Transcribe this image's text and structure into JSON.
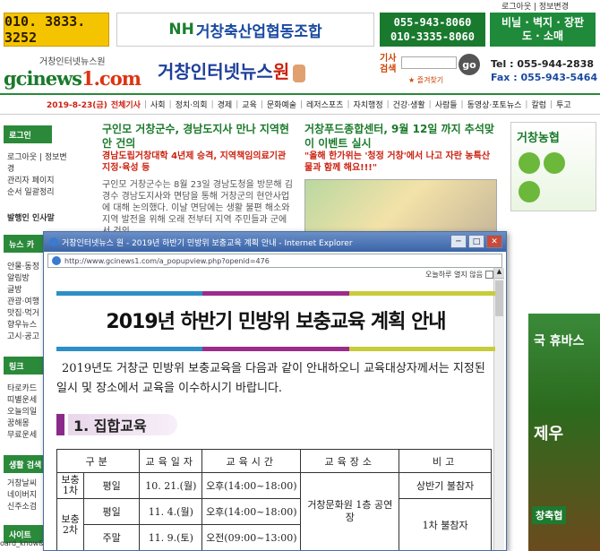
{
  "top_links": "로그아웃 | 정보변경",
  "ads": {
    "phone": "010. 3833. 3252",
    "nh_prefix": "NH",
    "nh_name": "거창축산업협동조합",
    "green_phone1": "055-943-8060",
    "green_phone2": "010-3335-8060",
    "green2_line1": "비닐 · 벽지 · 장판",
    "green2_line2": "도 · 소매"
  },
  "logo": {
    "small": "거창인터넷뉴스원",
    "big_main": "gcinews",
    "big_accent": "1.com"
  },
  "site_title": {
    "main": "거창인터넷뉴스",
    "accent": "원"
  },
  "search": {
    "label1": "기사",
    "label2": "검색",
    "go": "go",
    "favorites": "★ 즐겨찾기"
  },
  "contact": {
    "tel": "Tel : 055-944-2838",
    "fax": "Fax : 055-943-5464"
  },
  "nav": {
    "date": "2019-8-23(금)",
    "items": [
      "전체기사",
      "사회",
      "정치·의회",
      "경제",
      "교육",
      "문화예술",
      "레저스포츠",
      "자치행정",
      "건강·생활",
      "사람들",
      "동영상·포토뉴스",
      "칼럼",
      "투고"
    ]
  },
  "sidebar": {
    "login_head": "로그인",
    "login_links": [
      "로그아웃 | 정보변",
      "경",
      "관리자 페이지",
      "순서 일괄정리"
    ],
    "greeting": "발행인 인사말",
    "news_head": "뉴스 카",
    "news_items": [
      "안물·동정",
      "알림방",
      "글방",
      "관광·여행",
      "맛집·먹거",
      "향우뉴스",
      "고시·공고"
    ],
    "link_head": "링크",
    "link_items": [
      "타로카드",
      "띠별운세",
      "오늘의일",
      "꿈해몽",
      "무료운세"
    ],
    "life_head": "생활 검색",
    "life_items": [
      "거창날씨",
      "네이버지",
      "신주소검"
    ],
    "site_head": "사이트"
  },
  "news1": {
    "title": "구인모 거창군수, 경남도지사 만나 지역현안 건의",
    "sub": "경남도립거창대학 4년제 승격, 지역책임의료기관 지정·육성 등",
    "body": "구인모 거창군수는 8월 23일 경남도청을 방문해 김경수 경남도지사와 면담을 통해 거창군의 현안사업에 대해 논의했다. 이날 면담에는 생활 불편 해소와 지역 발전을 위해 오래 전부터 지역 주민들과 군에서 건의"
  },
  "news2": {
    "title": "거창푸드종합센터, 9월 12일 까지 추석맞이 이벤트 실시",
    "sub": "\"올해 한가위는 '청정 거창'에서 나고 자란 농특산물과 함께 해요!!!\""
  },
  "right_ad": {
    "title": "거창농협",
    "bottom_text": "국 휴바스",
    "bottom_label": "창축협",
    "mid": "제우"
  },
  "status_text": "oard_know&",
  "popup": {
    "title": "거창인터넷뉴스 원 - 2019년 하반기 민방위 보충교육 계획 안내 - Internet Explorer",
    "url": "http://www.gcinews1.com/a_popupview.php?openid=476",
    "dont_show": "오늘하루 열지 않음",
    "buttons": [
      "─",
      "□",
      "✕"
    ],
    "stripe_colors": [
      "#2c8fc7",
      "#9b2c8c",
      "#c7cc3a"
    ],
    "doc_title": "2019년 하반기 민방위 보충교육 계획 안내",
    "intro": "2019년도 거창군 민방위 보충교육을 다음과 같이 안내하오니 교육대상자께서는 지정된 일시 및 장소에서 교육을 이수하시기 바랍니다.",
    "section": "1. 집합교육",
    "table": {
      "headers": [
        "구분",
        "교육일자",
        "교육시간",
        "교육장소",
        "비고"
      ],
      "group1": "보충 1차",
      "group2": "보충 2차",
      "rows": [
        {
          "type": "평일",
          "date": "10. 21.(월)",
          "time": "오후(14:00~18:00)"
        },
        {
          "type": "평일",
          "date": "11. 4.(월)",
          "time": "오후(14:00~18:00)"
        },
        {
          "type": "주말",
          "date": "11. 9.(토)",
          "time": "오전(09:00~13:00)"
        }
      ],
      "place": "거창문화원 1층 공연장",
      "note1": "상반기 불참자",
      "note2": "1차 불참자"
    }
  }
}
